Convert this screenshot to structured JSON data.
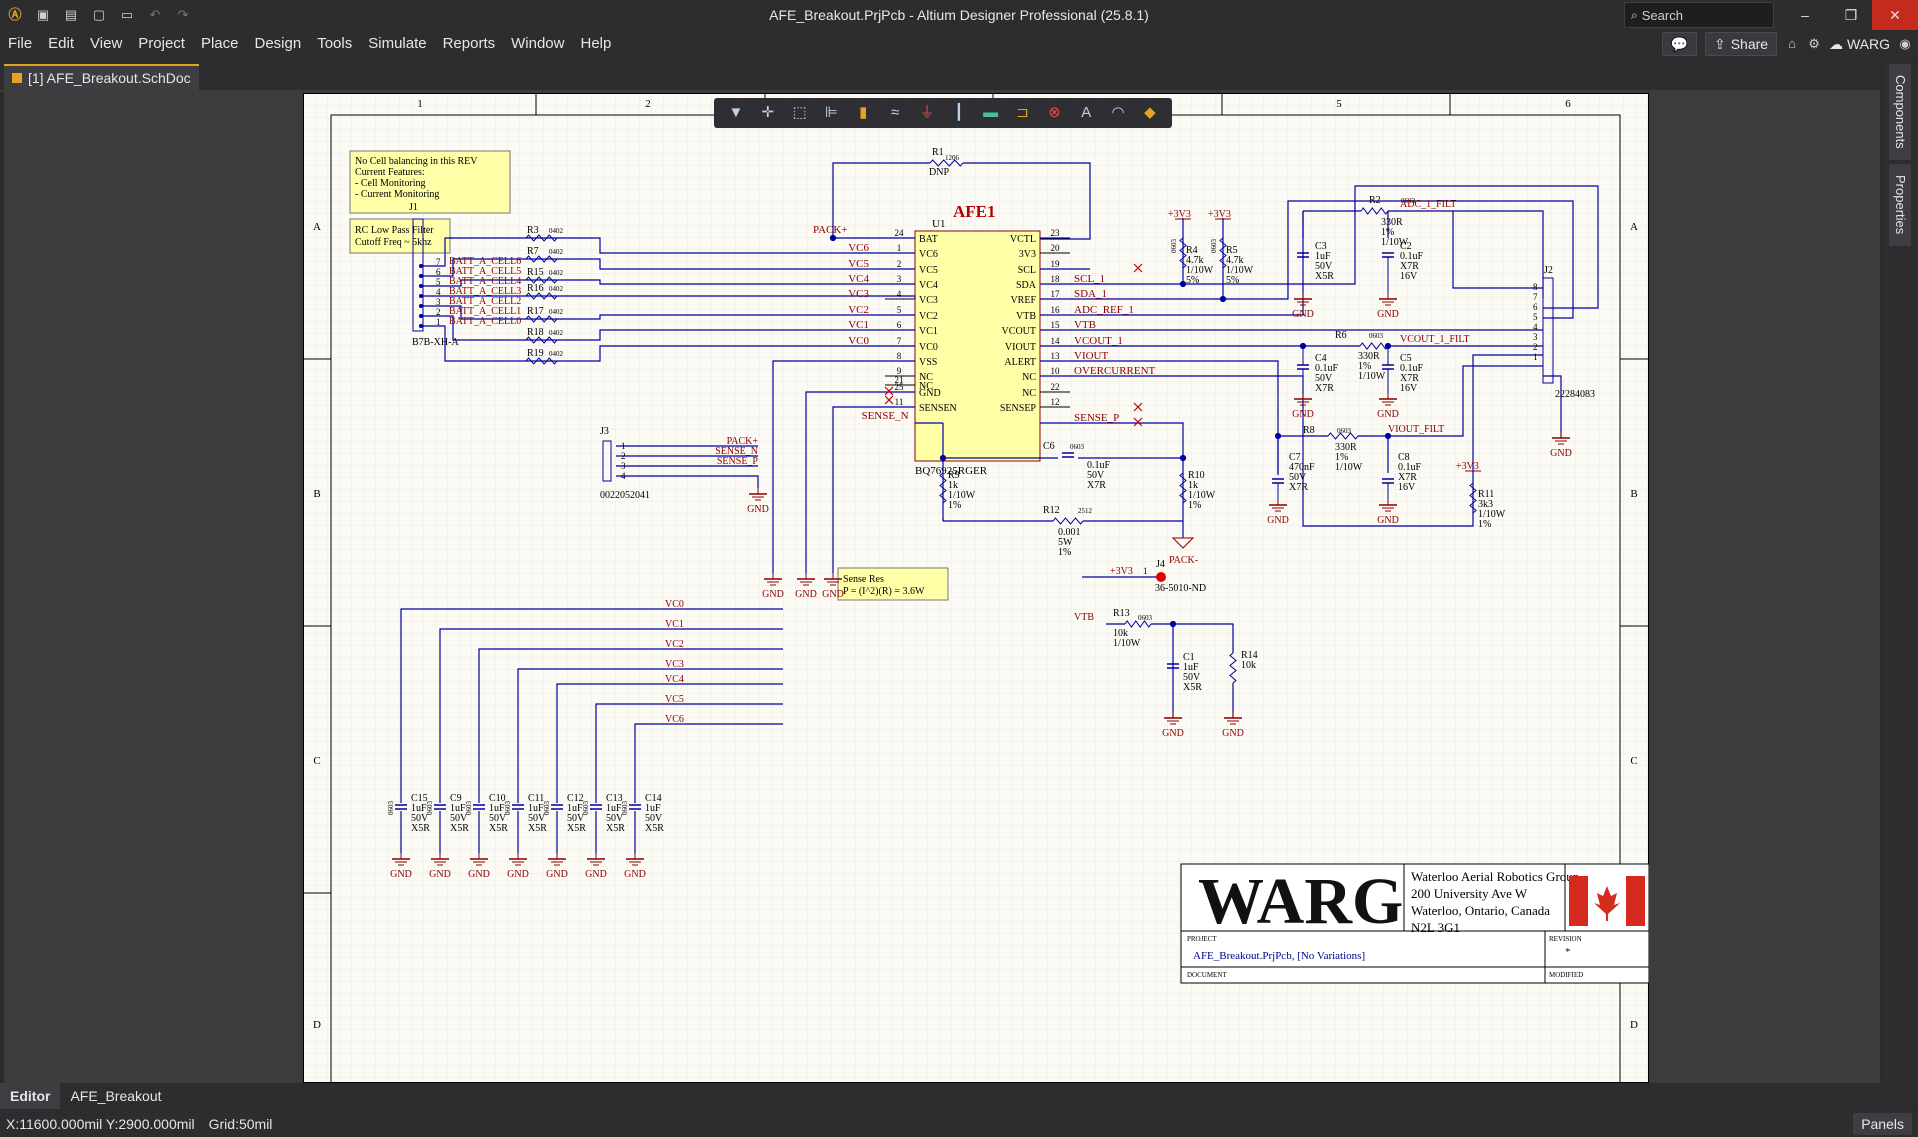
{
  "title": "AFE_Breakout.PrjPcb - Altium Designer Professional (25.8.1)",
  "search_placeholder": "Search",
  "window_controls": {
    "minimize": "–",
    "maximize": "❐",
    "close": "✕"
  },
  "menu": [
    "File",
    "Edit",
    "View",
    "Project",
    "Place",
    "Design",
    "Tools",
    "Simulate",
    "Reports",
    "Window",
    "Help"
  ],
  "menu_right": {
    "share": "Share",
    "user": "WARG"
  },
  "doc_tab": "[1] AFE_Breakout.SchDoc",
  "right_panels": [
    "Components",
    "Properties"
  ],
  "bottom_tabs": [
    "Editor",
    "AFE_Breakout"
  ],
  "status": {
    "coords": "X:11600.000mil Y:2900.000mil",
    "grid": "Grid:50mil",
    "panels": "Panels"
  },
  "schematic": {
    "zone_cols": [
      "1",
      "2",
      "3",
      "4",
      "5",
      "6"
    ],
    "zone_rows": [
      "A",
      "B",
      "C",
      "D"
    ],
    "notes": [
      [
        "No Cell balancing in this REV",
        "Current Features:",
        "- Cell Monitoring",
        "- Current Monitoring"
      ],
      [
        "RC Low Pass Filter",
        "Cutoff Freq ~ 5khz"
      ],
      [
        "Sense Res",
        "P = (I^2)(R) = 3.6W"
      ]
    ],
    "ic": {
      "designator": "U1",
      "name": "AFE1",
      "part": "BQ76925RGER",
      "left_pins": [
        [
          "BAT",
          "24"
        ],
        [
          "VC6",
          "1"
        ],
        [
          "VC5",
          "2"
        ],
        [
          "VC4",
          "3"
        ],
        [
          "VC3",
          "4"
        ],
        [
          "VC2",
          "5"
        ],
        [
          "VC1",
          "6"
        ],
        [
          "VC0",
          "7"
        ],
        [
          "VSS",
          "8"
        ],
        [
          "NC",
          "9"
        ],
        [
          "NC",
          "21"
        ],
        [
          "GND",
          "25"
        ],
        [
          "SENSEN",
          "11"
        ]
      ],
      "right_pins": [
        [
          "VCTL",
          "23"
        ],
        [
          "3V3",
          "20"
        ],
        [
          "SCL",
          "19"
        ],
        [
          "SDA",
          "18"
        ],
        [
          "VREF",
          "17"
        ],
        [
          "VTB",
          "16"
        ],
        [
          "VCOUT",
          "15"
        ],
        [
          "VIOUT",
          "14"
        ],
        [
          "ALERT",
          "13"
        ],
        [
          "NC",
          "10"
        ],
        [
          "NC",
          "22"
        ],
        [
          "SENSEP",
          "12"
        ]
      ]
    },
    "right_nets": [
      "SCL_1",
      "SDA_1",
      "ADC_REF_1",
      "VTB",
      "VCOUT_1",
      "VIOUT",
      "OVERCURRENT",
      "SENSE_P"
    ],
    "left_nets": [
      "VC6",
      "VC5",
      "VC4",
      "VC3",
      "VC2",
      "VC1",
      "VC0"
    ],
    "pack_plus": "PACK+",
    "pack_minus": "PACK-",
    "sense_n": "SENSE_N",
    "j1": {
      "ref": "J1",
      "part": "B7B-XH-A",
      "pins": [
        "7",
        "6",
        "5",
        "4",
        "3",
        "2",
        "1"
      ],
      "nets": [
        "BATT_A_CELL6",
        "BATT_A_CELL5",
        "BATT_A_CELL4",
        "BATT_A_CELL3",
        "BATT_A_CELL2",
        "BATT_A_CELL1",
        "BATT_A_CELL0"
      ]
    },
    "cell_res": [
      "R3",
      "R7",
      "R15",
      "R16",
      "R17",
      "R18",
      "R19"
    ],
    "fp_0402": "0402",
    "fp_0603": "0603",
    "fp_1206": "1206",
    "fp_2512": "2512",
    "r1": {
      "ref": "R1",
      "val": "DNP"
    },
    "r4": {
      "ref": "R4",
      "lines": [
        "4.7k",
        "1/10W",
        "5%"
      ]
    },
    "r5": {
      "ref": "R5",
      "lines": [
        "4.7k",
        "1/10W",
        "5%"
      ]
    },
    "v33": "+3V3",
    "gnd": "GND",
    "r2": {
      "ref": "R2",
      "lines": [
        "330R",
        "1%",
        "1/10W"
      ]
    },
    "c3": {
      "ref": "C3",
      "lines": [
        "1uF",
        "50V",
        "X5R"
      ]
    },
    "c2": {
      "ref": "C2",
      "lines": [
        "0.1uF",
        "X7R",
        "16V"
      ]
    },
    "adc_filt": "ADC_1_FILT",
    "r6": {
      "ref": "R6",
      "lines": [
        "330R",
        "1%",
        "1/10W"
      ]
    },
    "c4": {
      "ref": "C4",
      "lines": [
        "0.1uF",
        "50V",
        "X7R"
      ]
    },
    "c5": {
      "ref": "C5",
      "lines": [
        "0.1uF",
        "X7R",
        "16V"
      ]
    },
    "vcout_filt": "VCOUT_1_FILT",
    "j2": {
      "ref": "J2",
      "part": "22284083",
      "pins": [
        "8",
        "7",
        "6",
        "5",
        "4",
        "3",
        "2",
        "1"
      ]
    },
    "r8": {
      "ref": "R8",
      "lines": [
        "330R",
        "1%",
        "1/10W"
      ]
    },
    "c7": {
      "ref": "C7",
      "lines": [
        "470nF",
        "50V",
        "X7R"
      ]
    },
    "c8": {
      "ref": "C8",
      "lines": [
        "0.1uF",
        "X7R",
        "16V"
      ]
    },
    "viout_filt": "VIOUT_FILT",
    "r11": {
      "ref": "R11",
      "lines": [
        "3k3",
        "1/10W",
        "1%"
      ]
    },
    "j3": {
      "ref": "J3",
      "part": "0022052041",
      "pins": [
        "1",
        "2",
        "3",
        "4"
      ],
      "nets": [
        "PACK+",
        "SENSE_N",
        "SENSE_P"
      ]
    },
    "c6": {
      "ref": "C6",
      "lines": [
        "0.1uF",
        "50V",
        "X7R"
      ]
    },
    "r9": {
      "ref": "R9",
      "lines": [
        "1k",
        "1/10W",
        "1%"
      ]
    },
    "r10": {
      "ref": "R10",
      "lines": [
        "1k",
        "1/10W",
        "1%"
      ]
    },
    "r12": {
      "ref": "R12",
      "lines": [
        "0.001",
        "5W",
        "1%"
      ]
    },
    "j4": {
      "ref": "J4",
      "part": "36-5010-ND",
      "pin": "1",
      "net": "+3V3"
    },
    "r13": {
      "ref": "R13",
      "lines": [
        "10k",
        "1/10W"
      ]
    },
    "c1": {
      "ref": "C1",
      "lines": [
        "1uF",
        "50V",
        "X5R"
      ]
    },
    "r14": {
      "ref": "R14",
      "lines": [
        "10k"
      ]
    },
    "vtb": "VTB",
    "bottom_nets": [
      "VC0",
      "VC1",
      "VC2",
      "VC3",
      "VC4",
      "VC5",
      "VC6"
    ],
    "bottom_caps": [
      "C15",
      "C9",
      "C10",
      "C11",
      "C12",
      "C13",
      "C14"
    ],
    "bottom_cap_lines": [
      "1uF",
      "50V",
      "X5R"
    ],
    "title_block": {
      "logo": "WARG",
      "org": [
        "Waterloo Aerial Robotics Group",
        "200 University Ave W",
        "Waterloo, Ontario, Canada",
        "N2L 3G1"
      ],
      "project_label": "PROJECT",
      "project": "AFE_Breakout.PrjPcb, [No Variations]",
      "revision_label": "REVISION",
      "revision": "*",
      "document_label": "DOCUMENT",
      "modified_label": "MODIFIED"
    }
  },
  "colors": {
    "wire": "#0000a0",
    "net": "#8b0000",
    "ic_fill": "#ffffa8",
    "accent": "#e3a424"
  }
}
